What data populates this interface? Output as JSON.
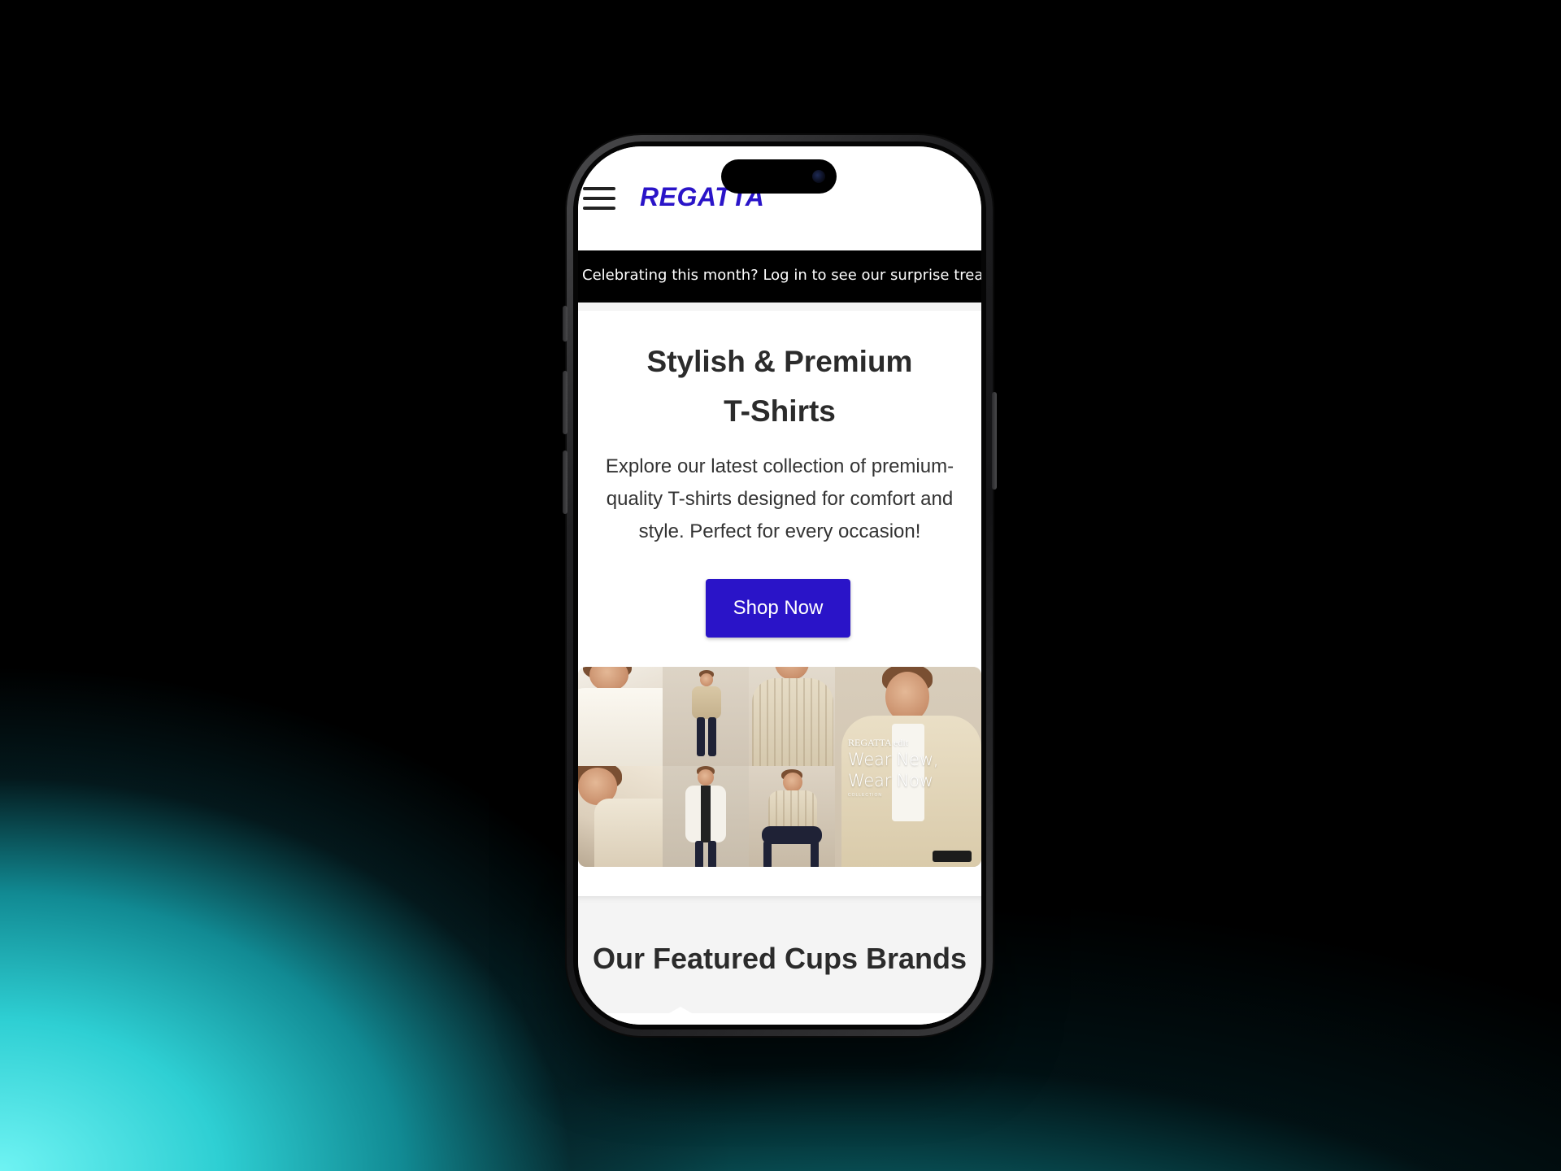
{
  "header": {
    "logo": "REGATTA",
    "menu_icon": "hamburger-menu-icon"
  },
  "announcement": {
    "text": "Celebrating this month? Log in to see our surprise trea"
  },
  "hero": {
    "title_line1": "Stylish & Premium",
    "title_line2": "T-Shirts",
    "description": "Explore our latest collection of premium-quality T-shirts designed for comfort and style. Perfect for every occasion!",
    "cta_label": "Shop Now"
  },
  "banner": {
    "eyebrow": "REGATTA edit",
    "headline_line1": "Wear New,",
    "headline_line2": "Wear Now",
    "tag": "COLLECTION"
  },
  "featured": {
    "title": "Our Featured Cups Brands"
  },
  "colors": {
    "brand": "#2a14c8",
    "announcement_bg": "#000000",
    "text_dark": "#2b2b2b",
    "section_bg": "#f4f4f4"
  }
}
